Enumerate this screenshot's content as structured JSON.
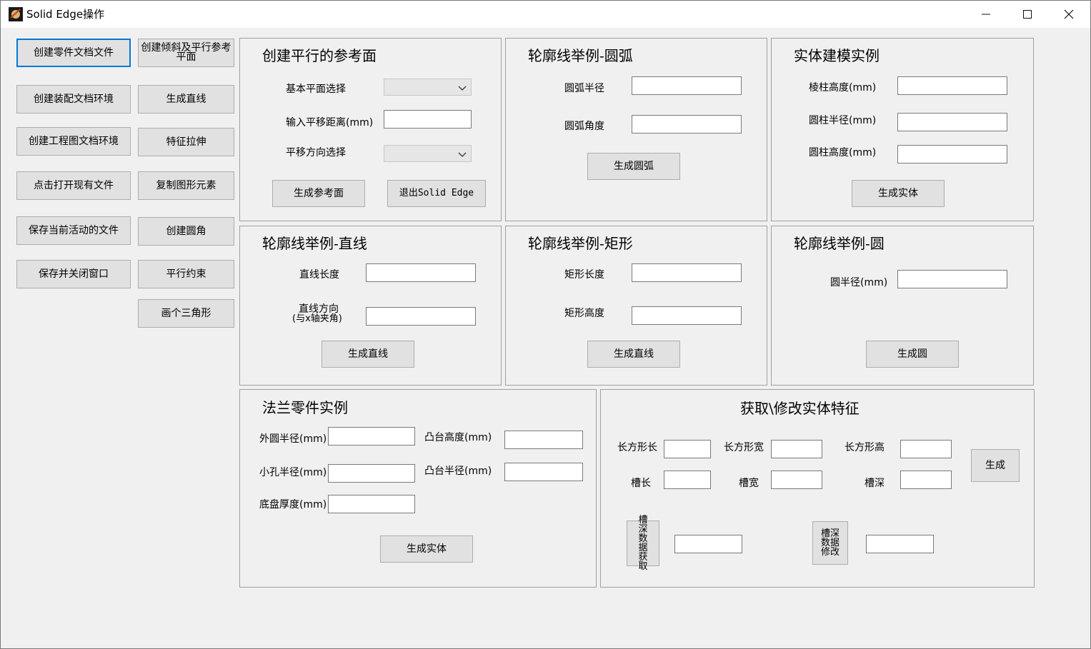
{
  "window": {
    "title": "Solid Edge操作"
  },
  "left_buttons": {
    "create_part": "创建零件文档文件",
    "create_assembly": "创建装配文档环境",
    "create_drawing": "创建工程图文档环境",
    "open_existing": "点击打开现有文件",
    "save_active": "保存当前活动的文件",
    "save_close": "保存并关闭窗口",
    "create_inclined_plane": "创建倾斜及平行参考平面",
    "make_line": "生成直线",
    "extrude": "特征拉伸",
    "copy_elements": "复制图形元素",
    "create_fillet": "创建圆角",
    "parallel_constraint": "平行约束",
    "draw_triangle": "画个三角形"
  },
  "ref_plane": {
    "title": "创建平行的参考面",
    "base_plane_label": "基本平面选择",
    "base_plane_value": "",
    "offset_label": "输入平移距离(mm)",
    "offset_value": "",
    "direction_label": "平移方向选择",
    "direction_value": "",
    "create_button": "生成参考面",
    "exit_button": "退出Solid Edge"
  },
  "arc": {
    "title": "轮廓线举例-圆弧",
    "radius_label": "圆弧半径",
    "radius_value": "",
    "angle_label": "圆弧角度",
    "angle_value": "",
    "create_button": "生成圆弧"
  },
  "solid": {
    "title": "实体建模实例",
    "prism_height_label": "棱柱高度(mm)",
    "prism_height_value": "",
    "cyl_radius_label": "圆柱半径(mm)",
    "cyl_radius_value": "",
    "cyl_height_label": "圆柱高度(mm)",
    "cyl_height_value": "",
    "create_button": "生成实体"
  },
  "line": {
    "title": "轮廓线举例-直线",
    "length_label": "直线长度",
    "length_value": "",
    "direction_label_1": "直线方向",
    "direction_label_2": "(与x轴夹角)",
    "direction_value": "",
    "create_button": "生成直线"
  },
  "rect": {
    "title": "轮廓线举例-矩形",
    "length_label": "矩形长度",
    "length_value": "",
    "height_label": "矩形高度",
    "height_value": "",
    "create_button": "生成直线"
  },
  "circle": {
    "title": "轮廓线举例-圆",
    "radius_label": "圆半径(mm)",
    "radius_value": "",
    "create_button": "生成圆"
  },
  "flange": {
    "title": "法兰零件实例",
    "outer_radius_label": "外圆半径(mm)",
    "outer_radius_value": "",
    "hole_radius_label": "小孔半径(mm)",
    "hole_radius_value": "",
    "base_thickness_label": "底盘厚度(mm)",
    "base_thickness_value": "",
    "boss_height_label": "凸台高度(mm)",
    "boss_height_value": "",
    "boss_radius_label": "凸台半径(mm)",
    "boss_radius_value": "",
    "create_button": "生成实体"
  },
  "feature": {
    "title": "获取\\修改实体特征",
    "box_length_label": "长方形长",
    "box_length_value": "",
    "box_width_label": "长方形宽",
    "box_width_value": "",
    "box_height_label": "长方形高",
    "box_height_value": "",
    "slot_length_label": "槽长",
    "slot_length_value": "",
    "slot_width_label": "槽宽",
    "slot_width_value": "",
    "slot_depth_label": "槽深",
    "slot_depth_value": "",
    "generate_button": "生成",
    "get_depth_button": "槽深数据获取",
    "get_depth_value": "",
    "modify_depth_button": "槽深数据修改",
    "modify_depth_value": ""
  }
}
